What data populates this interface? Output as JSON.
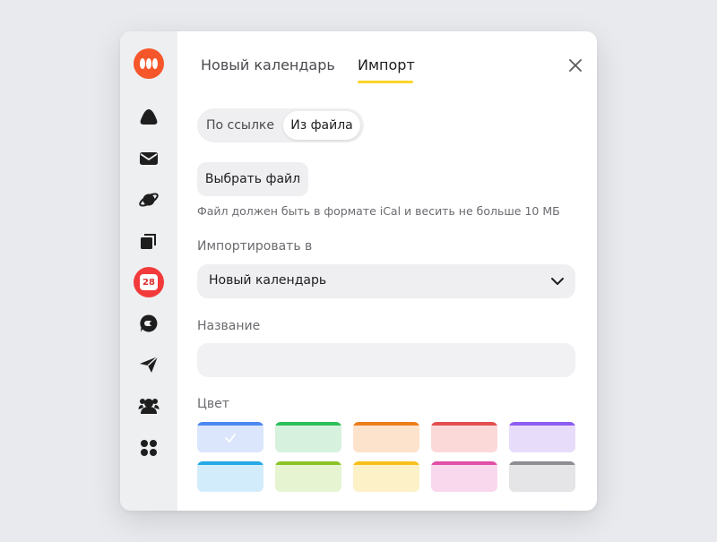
{
  "dialog": {
    "tabs": [
      {
        "label": "Новый календарь",
        "active": false
      },
      {
        "label": "Импорт",
        "active": true
      }
    ],
    "source_switch": {
      "options": [
        "По ссылке",
        "Из файла"
      ],
      "selected": "Из файла"
    },
    "choose_file_label": "Выбрать файл",
    "file_hint": "Файл должен быть в формате iCal и весить не больше 10 МБ",
    "import_to": {
      "label": "Импортировать в",
      "value": "Новый календарь"
    },
    "name": {
      "label": "Название",
      "value": "",
      "placeholder": ""
    },
    "color": {
      "label": "Цвет",
      "selected_index": 0,
      "swatches": [
        {
          "name": "blue",
          "bar": "#4b87f0",
          "fill": "#dbe6fc"
        },
        {
          "name": "green",
          "bar": "#2dbf5a",
          "fill": "#d6f2de"
        },
        {
          "name": "orange",
          "bar": "#ec7d1b",
          "fill": "#fde3cb"
        },
        {
          "name": "red",
          "bar": "#e34f4f",
          "fill": "#fbd9d9"
        },
        {
          "name": "purple",
          "bar": "#8f5cf0",
          "fill": "#e8dcfb"
        },
        {
          "name": "light-blue",
          "bar": "#26a9e6",
          "fill": "#d3ecfb"
        },
        {
          "name": "lime",
          "bar": "#8cc428",
          "fill": "#e6f4d1"
        },
        {
          "name": "yellow",
          "bar": "#f6c11c",
          "fill": "#fdf1c8"
        },
        {
          "name": "pink",
          "bar": "#e04fa6",
          "fill": "#f9d8ee"
        },
        {
          "name": "gray",
          "bar": "#8d8d92",
          "fill": "#e5e5e7"
        }
      ]
    }
  },
  "rail": {
    "calendar_day": "28",
    "items": [
      "logo-icon",
      "cloud-drop-icon",
      "mail-icon",
      "planet-icon",
      "documents-icon",
      "calendar-icon",
      "messenger-icon",
      "send-icon",
      "people-icon",
      "apps-icon"
    ]
  },
  "colors": {
    "accent_yellow": "#fed42b",
    "logo_orange": "#f5572a",
    "calendar_red": "#f23a3a"
  }
}
